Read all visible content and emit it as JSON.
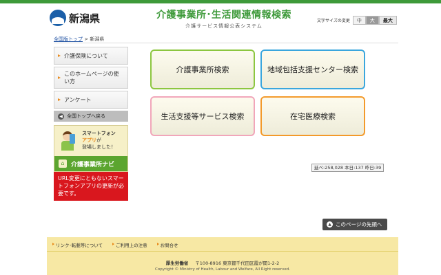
{
  "header": {
    "prefecture_name": "新潟県",
    "title": "介護事業所･生活関連情報検索",
    "subtitle": "介護サービス情報公表システム",
    "font_size": {
      "label": "文字サイズの変更",
      "options": [
        "中",
        "大",
        "最大"
      ]
    }
  },
  "breadcrumb": {
    "home_link": "全国版トップ",
    "separator": ">",
    "current": "新潟県"
  },
  "sidebar": {
    "items": [
      {
        "label": "介護保険について"
      },
      {
        "label": "このホームページの使い方"
      },
      {
        "label": "アンケート"
      }
    ],
    "back_label": "全国トップへ戻る",
    "app_banner": {
      "line1": "スマートフォン",
      "line2": "アプリ",
      "line2_suffix": "が",
      "line3": "登場しました！",
      "nav_label": "介護事業所ナビ"
    },
    "notice": "URL変更にともないスマートフォンアプリの更新が必要です。"
  },
  "menu": {
    "buttons": [
      {
        "label": "介護事業所検索"
      },
      {
        "label": "地域包括支援センター検索"
      },
      {
        "label": "生活支援等サービス検索"
      },
      {
        "label": "在宅医療検索"
      }
    ]
  },
  "counter": {
    "text": "延べ:258,028 本日:137 昨日:39"
  },
  "page_top": {
    "label": "このページの先頭へ"
  },
  "footer": {
    "links": [
      "リンク･転載等について",
      "ご利用上の注意",
      "お問合せ"
    ],
    "org_name": "厚生労働省",
    "address": "〒100-8916 東京都千代田区霞が関1-2-2",
    "copyright": "Copyright © Ministry of Health, Labour and Welfare, All Right reserved."
  },
  "colors": {
    "brand_green": "#3e9a3a",
    "notice_red": "#d9171e",
    "footer_yellow": "#f7e8a4"
  }
}
